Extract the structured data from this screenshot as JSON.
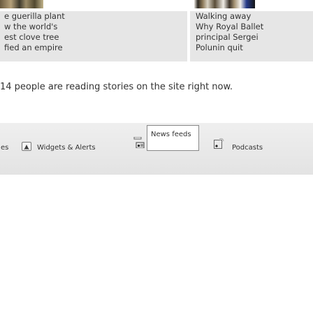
{
  "stories": {
    "left": {
      "lines": [
        "e guerilla plant",
        "w the world's",
        "est clove tree",
        "fied an empire"
      ]
    },
    "right": {
      "lines": [
        "Walking away",
        "Why Royal Ballet",
        "principal Sergei",
        "Polunin quit"
      ]
    }
  },
  "readers": {
    "text": "14 people are reading stories on the site right now."
  },
  "bottom_nav": {
    "partial_label": "es",
    "items": [
      {
        "label": "Widgets & Alerts",
        "icon": "widgets-icon"
      },
      {
        "label": "News feeds",
        "icon": "news-feed-icon",
        "selected": true
      },
      {
        "label": "Podcasts",
        "icon": "podcast-icon"
      }
    ]
  },
  "colors": {
    "bar_background": "#e8e8e8",
    "text": "#333333",
    "news_box_border": "#888888"
  }
}
